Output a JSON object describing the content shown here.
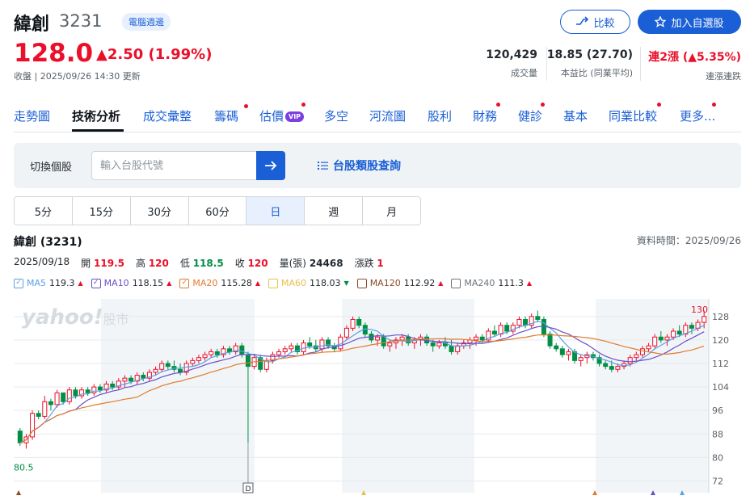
{
  "stock": {
    "name": "緯創",
    "code": "3231",
    "tag": "電腦週邊",
    "price": "128.0",
    "change": "▲2.50 (1.99%)",
    "close_label": "收盤 | 2025/09/26 14:30 更新"
  },
  "buttons": {
    "compare": "比較",
    "add_watchlist": "加入自選股"
  },
  "stats": [
    {
      "value": "120,429",
      "label": "成交量"
    },
    {
      "value": "18.85 (27.70)",
      "label": "本益比 (同業平均)"
    },
    {
      "value": "連2漲 (▲5.35%)",
      "label": "連漲連跌"
    }
  ],
  "nav": [
    {
      "label": "走勢圖"
    },
    {
      "label": "技術分析"
    },
    {
      "label": "成交彙整"
    },
    {
      "label": "籌碼"
    },
    {
      "label": "估價"
    },
    {
      "label": "多空"
    },
    {
      "label": "河流圖"
    },
    {
      "label": "股利"
    },
    {
      "label": "財務"
    },
    {
      "label": "健診"
    },
    {
      "label": "基本"
    },
    {
      "label": "同業比較"
    },
    {
      "label": "更多..."
    }
  ],
  "vip": "VIP",
  "search": {
    "label": "切換個股",
    "placeholder": "輸入台股代號",
    "category_link": "台股類股查詢"
  },
  "periods": [
    "5分",
    "15分",
    "30分",
    "60分",
    "日",
    "週",
    "月"
  ],
  "chart_header": {
    "title": "緯創 (3231)",
    "data_time": "資料時間：2025/09/26"
  },
  "ohlc": {
    "date": "2025/09/18",
    "open_label": "開",
    "open": "119.5",
    "high_label": "高",
    "high": "120",
    "low_label": "低",
    "low": "118.5",
    "close_label": "收",
    "close": "120",
    "volume_label": "量(張)",
    "volume": "24468",
    "change_label": "漲跌",
    "change": "1"
  },
  "ma": [
    {
      "label": "MA5",
      "value": "119.3",
      "dir": "up",
      "color": "#5aa0e6"
    },
    {
      "label": "MA10",
      "value": "118.15",
      "dir": "up",
      "color": "#6a4fc8"
    },
    {
      "label": "MA20",
      "value": "115.28",
      "dir": "up",
      "color": "#e07b2e"
    },
    {
      "label": "MA60",
      "value": "118.03",
      "dir": "down",
      "color": "#e8c04a"
    },
    {
      "label": "MA120",
      "value": "112.92",
      "dir": "up",
      "color": "#8b4a2a"
    },
    {
      "label": "MA240",
      "value": "111.3",
      "dir": "up",
      "color": "#6e757c"
    }
  ],
  "watermark": {
    "brand": "yahoo!",
    "suffix": "股市"
  },
  "chart_data": {
    "type": "candlestick",
    "y_ticks": [
      128,
      120,
      112,
      104,
      96,
      88,
      80,
      72
    ],
    "ylim": [
      68,
      134
    ],
    "max_label": "130",
    "min_label": "80.5",
    "event_marker": "D",
    "candles": [
      [
        89,
        90,
        84,
        85
      ],
      [
        85,
        88,
        83,
        87
      ],
      [
        87,
        96,
        86,
        95
      ],
      [
        95,
        96,
        93,
        94
      ],
      [
        94,
        101,
        93,
        99
      ],
      [
        99,
        100,
        96,
        98
      ],
      [
        98,
        103,
        97,
        102
      ],
      [
        102,
        102,
        98,
        99
      ],
      [
        99,
        104,
        98,
        103
      ],
      [
        103,
        104,
        100,
        101
      ],
      [
        101,
        104,
        100,
        103
      ],
      [
        103,
        104,
        101,
        102
      ],
      [
        102,
        105,
        101,
        104
      ],
      [
        104,
        105,
        102,
        103
      ],
      [
        103,
        106,
        102,
        105
      ],
      [
        105,
        106,
        103,
        104
      ],
      [
        104,
        107,
        103,
        106
      ],
      [
        106,
        108,
        104,
        107
      ],
      [
        107,
        108,
        105,
        106
      ],
      [
        106,
        109,
        105,
        108
      ],
      [
        108,
        109,
        106,
        107
      ],
      [
        107,
        110,
        106,
        109
      ],
      [
        109,
        111,
        108,
        110
      ],
      [
        110,
        113,
        109,
        112
      ],
      [
        112,
        113,
        110,
        111
      ],
      [
        111,
        113,
        109,
        110
      ],
      [
        110,
        112,
        108,
        109
      ],
      [
        109,
        113,
        108,
        112
      ],
      [
        112,
        114,
        111,
        113
      ],
      [
        113,
        115,
        112,
        114
      ],
      [
        114,
        116,
        113,
        115
      ],
      [
        115,
        117,
        114,
        116
      ],
      [
        116,
        117,
        114,
        115
      ],
      [
        115,
        118,
        114,
        117
      ],
      [
        117,
        118,
        115,
        116
      ],
      [
        116,
        119,
        115,
        118
      ],
      [
        118,
        119,
        114,
        115
      ],
      [
        115,
        116,
        85,
        111
      ],
      [
        111,
        115,
        110,
        114
      ],
      [
        114,
        115,
        109,
        110
      ],
      [
        110,
        114,
        109,
        113
      ],
      [
        113,
        116,
        112,
        115
      ],
      [
        115,
        117,
        114,
        116
      ],
      [
        116,
        118,
        115,
        117
      ],
      [
        117,
        119,
        116,
        118
      ],
      [
        118,
        119,
        115,
        116
      ],
      [
        116,
        120,
        115,
        119
      ],
      [
        119,
        121,
        117,
        118
      ],
      [
        118,
        120,
        116,
        117
      ],
      [
        117,
        121,
        116,
        120
      ],
      [
        120,
        121,
        117,
        118
      ],
      [
        118,
        119,
        116,
        117
      ],
      [
        117,
        122,
        116,
        121
      ],
      [
        121,
        125,
        120,
        124
      ],
      [
        124,
        128,
        123,
        127
      ],
      [
        127,
        128,
        124,
        125
      ],
      [
        125,
        126,
        121,
        122
      ],
      [
        122,
        123,
        119,
        120
      ],
      [
        120,
        122,
        118,
        121
      ],
      [
        121,
        122,
        117,
        118
      ],
      [
        118,
        120,
        116,
        119
      ],
      [
        119,
        121,
        117,
        120
      ],
      [
        120,
        122,
        118,
        121
      ],
      [
        121,
        122,
        118,
        119
      ],
      [
        119,
        121,
        117,
        120
      ],
      [
        120,
        122,
        118,
        121
      ],
      [
        121,
        122,
        118,
        119
      ],
      [
        119,
        120,
        116,
        118
      ],
      [
        118,
        120,
        117,
        119
      ],
      [
        119,
        121,
        117,
        118
      ],
      [
        118,
        120,
        115,
        116
      ],
      [
        116,
        119,
        115,
        118
      ],
      [
        118,
        120,
        117,
        119
      ],
      [
        119,
        121,
        117,
        120
      ],
      [
        120,
        122,
        118,
        121
      ],
      [
        121,
        122,
        119,
        120
      ],
      [
        120,
        124,
        119,
        123
      ],
      [
        123,
        125,
        121,
        122
      ],
      [
        122,
        126,
        121,
        125
      ],
      [
        125,
        126,
        122,
        123
      ],
      [
        123,
        126,
        122,
        125
      ],
      [
        125,
        128,
        124,
        127
      ],
      [
        127,
        128,
        124,
        125
      ],
      [
        125,
        129,
        124,
        128
      ],
      [
        128,
        130,
        126,
        127
      ],
      [
        127,
        128,
        121,
        122
      ],
      [
        122,
        123,
        117,
        118
      ],
      [
        118,
        119,
        116,
        117
      ],
      [
        117,
        118,
        114,
        115
      ],
      [
        115,
        117,
        113,
        116
      ],
      [
        116,
        117,
        112,
        113
      ],
      [
        113,
        115,
        111,
        114
      ],
      [
        114,
        116,
        112,
        115
      ],
      [
        115,
        116,
        113,
        114
      ],
      [
        114,
        115,
        111,
        112
      ],
      [
        112,
        113,
        110,
        111
      ],
      [
        111,
        113,
        109,
        110
      ],
      [
        110,
        112,
        109,
        111
      ],
      [
        111,
        113,
        110,
        112
      ],
      [
        112,
        115,
        111,
        114
      ],
      [
        114,
        116,
        113,
        115
      ],
      [
        115,
        118,
        114,
        117
      ],
      [
        117,
        119,
        116,
        118
      ],
      [
        118,
        122,
        117,
        121
      ],
      [
        121,
        123,
        119,
        120
      ],
      [
        120,
        122,
        118,
        121
      ],
      [
        121,
        124,
        120,
        123
      ],
      [
        123,
        125,
        121,
        122
      ],
      [
        122,
        126,
        121,
        125
      ],
      [
        125,
        126,
        122,
        124
      ],
      [
        124,
        127,
        123,
        126
      ],
      [
        126,
        130,
        124,
        128
      ]
    ]
  }
}
